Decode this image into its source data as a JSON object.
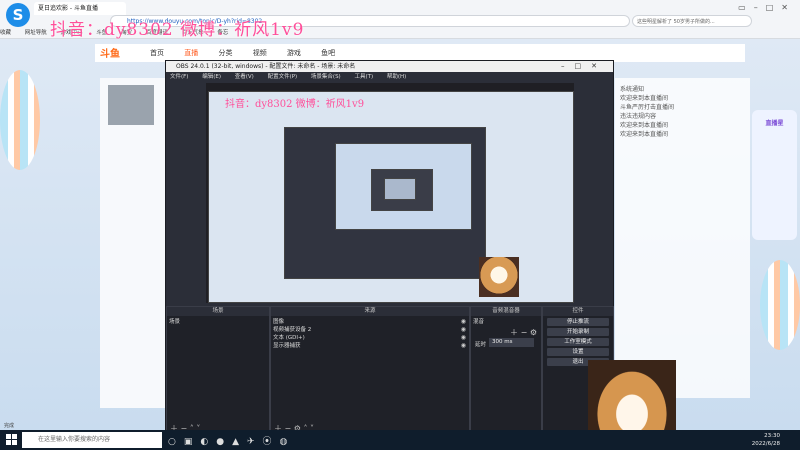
{
  "browser": {
    "tab_title": "夏日追欢影 - 斗鱼直播",
    "address": "https://www.douyu.com/topic/D-yh?rid=8302",
    "search_hint": "这些明星解析了 50岁男子所做的...",
    "bookmarks": [
      "收藏",
      "网址导航",
      "游戏中心",
      "斗鱼",
      "淘宝",
      "百度翻译",
      "百元气象",
      "备忘"
    ]
  },
  "watermark": "抖音：dy8302 微博：祈风1v9",
  "site": {
    "logo": "斗鱼",
    "menu": [
      "首页",
      "直播",
      "分类",
      "视频",
      "游戏",
      "鱼吧"
    ],
    "active_menu": "直播",
    "right_text": [
      "系统通知",
      "欢迎来到本直播间",
      "斗鱼严厉打击直播间",
      "违法违规内容",
      "欢迎来到本直播间",
      "欢迎来到本直播间"
    ],
    "badge": "直播星"
  },
  "obs": {
    "title": "OBS 24.0.1 (32-bit, windows) - 配置文件: 未命名 - 场景: 未命名",
    "menu": [
      "文件(F)",
      "编辑(E)",
      "查看(V)",
      "配置文件(P)",
      "场景集合(S)",
      "工具(T)",
      "帮助(H)"
    ],
    "docks": {
      "scenes": {
        "title": "场景",
        "items": [
          "场景"
        ]
      },
      "sources": {
        "title": "来源",
        "items": [
          "图像",
          "视频捕获设备 2",
          "文本 (GDI+)",
          "显示器捕获"
        ]
      },
      "mixer": {
        "title": "音频混音器",
        "items": [
          "混音"
        ],
        "delay_label": "延时",
        "delay_value": "300 ms"
      },
      "controls": {
        "title": "控件",
        "buttons": [
          "停止推流",
          "开始录制",
          "工作室模式",
          "设置",
          "退出"
        ]
      }
    }
  },
  "taskbar": {
    "search_placeholder": "在这里输入你要搜索的内容",
    "time": "23:30",
    "date": "2022/6/28"
  },
  "status_bar": "完成"
}
